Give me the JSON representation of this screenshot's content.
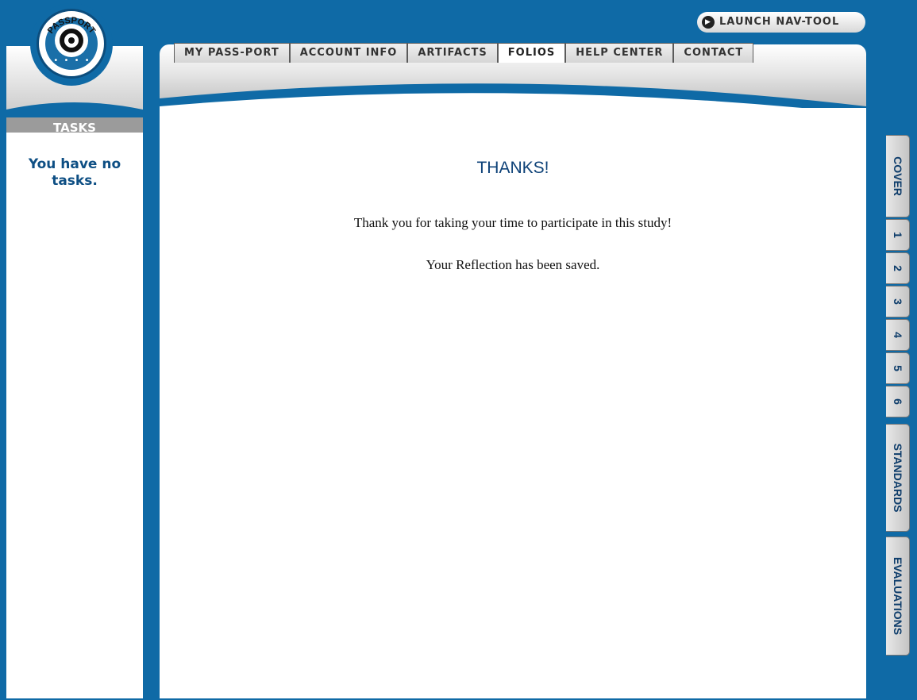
{
  "header": {
    "launch_label": "LAUNCH NAV-TOOL",
    "tabs": [
      "MY PASS-PORT",
      "ACCOUNT INFO",
      "ARTIFACTS",
      "FOLIOS",
      "HELP CENTER",
      "CONTACT"
    ],
    "active_tab": "FOLIOS"
  },
  "logo": {
    "text": "PASSPORT"
  },
  "sidebar": {
    "title": "TASKS",
    "empty_text": "You have no tasks."
  },
  "main": {
    "title": "THANKS!",
    "message": "Thank you for taking your time to participate in this study!",
    "saved": "Your Reflection has been saved."
  },
  "side_tabs": [
    "COVER",
    "1",
    "2",
    "3",
    "4",
    "5",
    "6",
    "STANDARDS",
    "EVALUATIONS"
  ],
  "colors": {
    "frame_blue": "#0f6aa6",
    "text_navy": "#0e4278",
    "tab_gray": "#d5d5d5"
  }
}
